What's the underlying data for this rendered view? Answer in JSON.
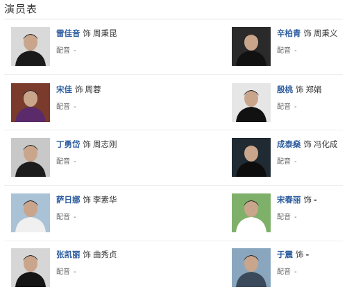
{
  "page": {
    "title": "演员表"
  },
  "cast": [
    {
      "actor": "雷佳音",
      "as_label": "饰",
      "role": "周秉昆",
      "dub_label": "配音",
      "dub_value": "-",
      "photo_bg": "#d9d9d9",
      "photo_fg": "#1a1a1a"
    },
    {
      "actor": "辛柏青",
      "as_label": "饰",
      "role": "周秉义",
      "dub_label": "配音",
      "dub_value": "-",
      "photo_bg": "#2a2a2a",
      "photo_fg": "#111111"
    },
    {
      "actor": "宋佳",
      "as_label": "饰",
      "role": "周蓉",
      "dub_label": "配音",
      "dub_value": "-",
      "photo_bg": "#7a3b2c",
      "photo_fg": "#5a2a6a"
    },
    {
      "actor": "殷桃",
      "as_label": "饰",
      "role": "郑娟",
      "dub_label": "配音",
      "dub_value": "-",
      "photo_bg": "#e6e6e6",
      "photo_fg": "#111111"
    },
    {
      "actor": "丁勇岱",
      "as_label": "饰",
      "role": "周志刚",
      "dub_label": "配音",
      "dub_value": "-",
      "photo_bg": "#c8c8c8",
      "photo_fg": "#1c1c1c"
    },
    {
      "actor": "成泰燊",
      "as_label": "饰",
      "role": "冯化成",
      "dub_label": "配音",
      "dub_value": "-",
      "photo_bg": "#1f2a33",
      "photo_fg": "#0d0d0d"
    },
    {
      "actor": "萨日娜",
      "as_label": "饰",
      "role": "李素华",
      "dub_label": "配音",
      "dub_value": "-",
      "photo_bg": "#a9c2d6",
      "photo_fg": "#f0f0f0"
    },
    {
      "actor": "宋春丽",
      "as_label": "饰",
      "role": "-",
      "dub_label": "配音",
      "dub_value": "-",
      "photo_bg": "#7fb06a",
      "photo_fg": "#ffffff"
    },
    {
      "actor": "张凯丽",
      "as_label": "饰",
      "role": "曲秀贞",
      "dub_label": "配音",
      "dub_value": "-",
      "photo_bg": "#d6d6d6",
      "photo_fg": "#151515"
    },
    {
      "actor": "于震",
      "as_label": "饰",
      "role": "-",
      "dub_label": "配音",
      "dub_value": "-",
      "photo_bg": "#8aa6bf",
      "photo_fg": "#3a4a5a"
    }
  ]
}
